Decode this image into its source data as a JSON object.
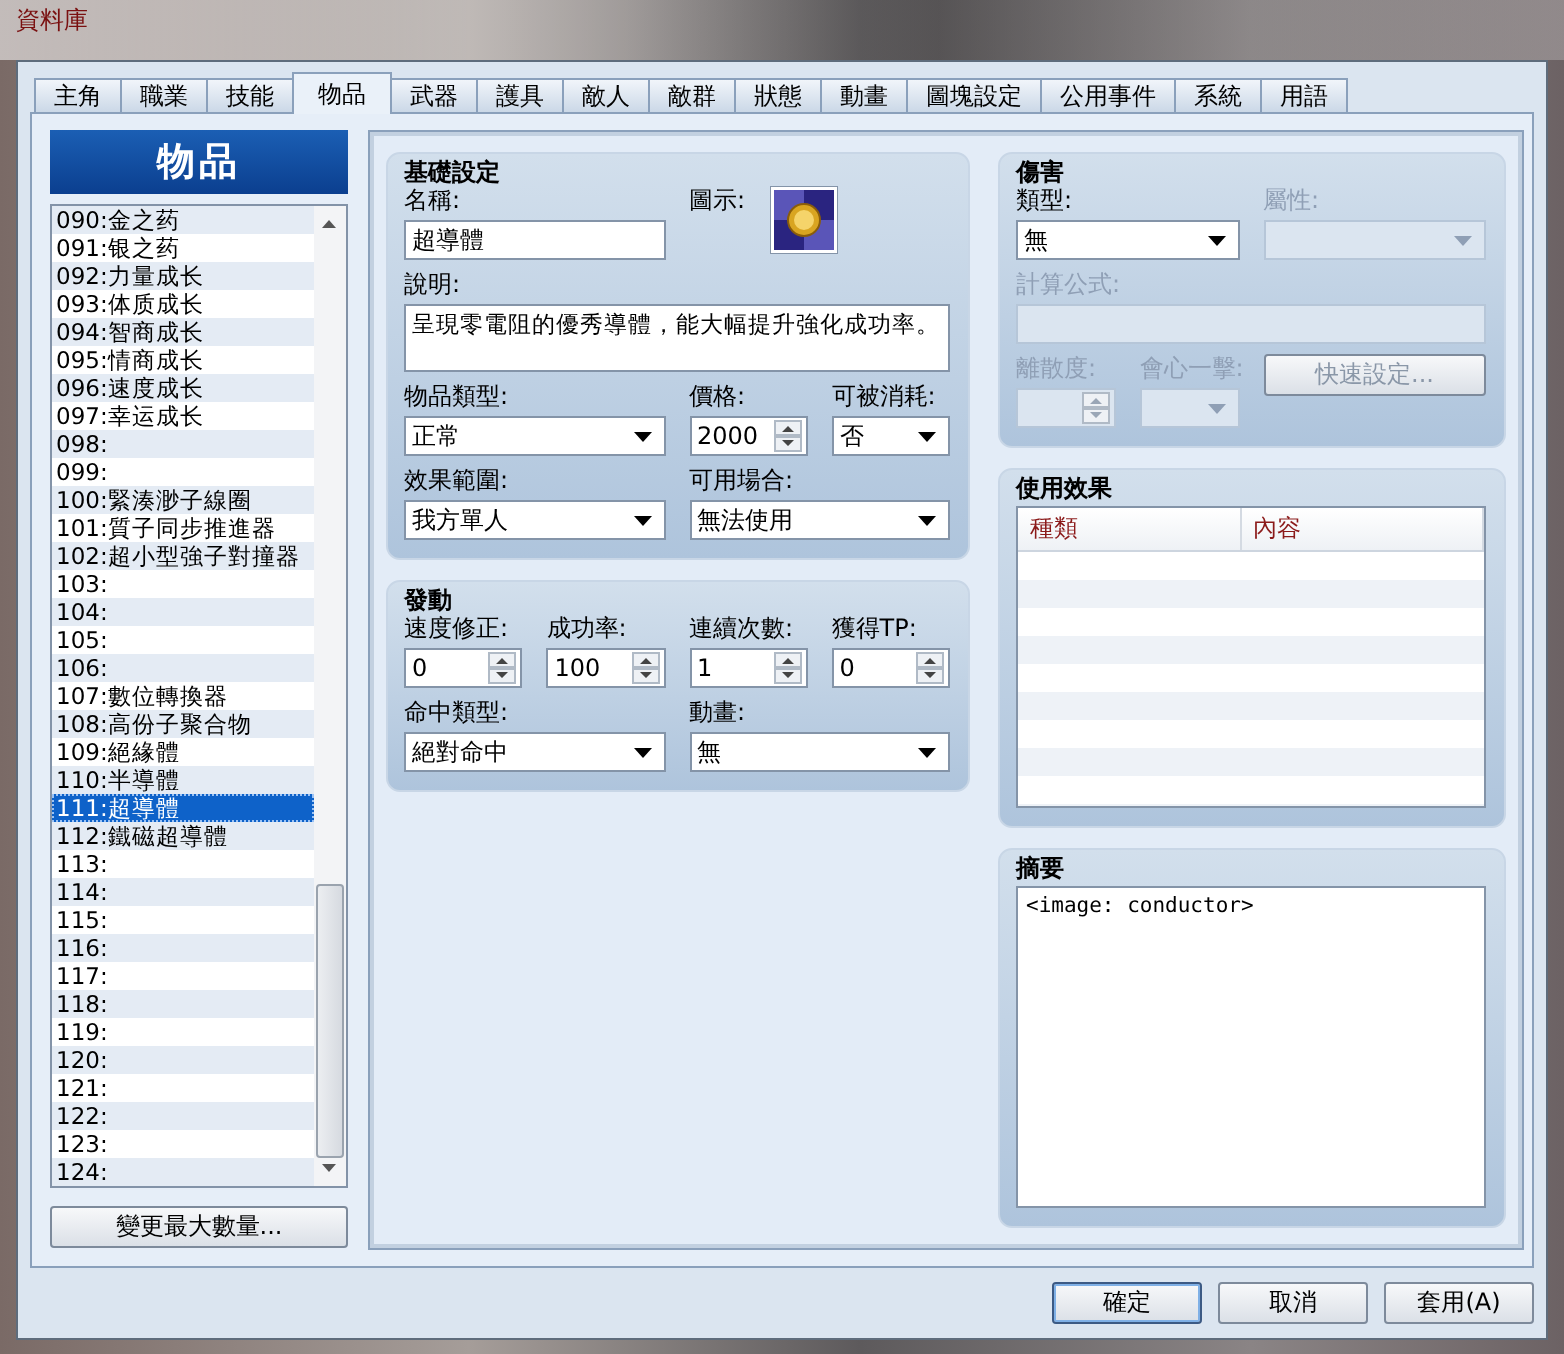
{
  "window": {
    "title": "資料庫"
  },
  "tabs": [
    {
      "label": "主角",
      "selected": false
    },
    {
      "label": "職業",
      "selected": false
    },
    {
      "label": "技能",
      "selected": false
    },
    {
      "label": "物品",
      "selected": true
    },
    {
      "label": "武器",
      "selected": false
    },
    {
      "label": "護具",
      "selected": false
    },
    {
      "label": "敵人",
      "selected": false
    },
    {
      "label": "敵群",
      "selected": false
    },
    {
      "label": "狀態",
      "selected": false
    },
    {
      "label": "動畫",
      "selected": false
    },
    {
      "label": "圖塊設定",
      "selected": false
    },
    {
      "label": "公用事件",
      "selected": false
    },
    {
      "label": "系統",
      "selected": false
    },
    {
      "label": "用語",
      "selected": false
    }
  ],
  "item_list": {
    "title": "物品",
    "items": [
      {
        "label": "090:金之药",
        "selected": false
      },
      {
        "label": "091:银之药",
        "selected": false
      },
      {
        "label": "092:力量成长",
        "selected": false
      },
      {
        "label": "093:体质成长",
        "selected": false
      },
      {
        "label": "094:智商成长",
        "selected": false
      },
      {
        "label": "095:情商成长",
        "selected": false
      },
      {
        "label": "096:速度成长",
        "selected": false
      },
      {
        "label": "097:幸运成长",
        "selected": false
      },
      {
        "label": "098:",
        "selected": false
      },
      {
        "label": "099:",
        "selected": false
      },
      {
        "label": "100:緊湊渺子線圈",
        "selected": false
      },
      {
        "label": "101:質子同步推進器",
        "selected": false
      },
      {
        "label": "102:超小型強子對撞器",
        "selected": false
      },
      {
        "label": "103:",
        "selected": false
      },
      {
        "label": "104:",
        "selected": false
      },
      {
        "label": "105:",
        "selected": false
      },
      {
        "label": "106:",
        "selected": false
      },
      {
        "label": "107:數位轉換器",
        "selected": false
      },
      {
        "label": "108:高份子聚合物",
        "selected": false
      },
      {
        "label": "109:絕緣體",
        "selected": false
      },
      {
        "label": "110:半導體",
        "selected": false
      },
      {
        "label": "111:超導體",
        "selected": true
      },
      {
        "label": "112:鐵磁超導體",
        "selected": false
      },
      {
        "label": "113:",
        "selected": false
      },
      {
        "label": "114:",
        "selected": false
      },
      {
        "label": "115:",
        "selected": false
      },
      {
        "label": "116:",
        "selected": false
      },
      {
        "label": "117:",
        "selected": false
      },
      {
        "label": "118:",
        "selected": false
      },
      {
        "label": "119:",
        "selected": false
      },
      {
        "label": "120:",
        "selected": false
      },
      {
        "label": "121:",
        "selected": false
      },
      {
        "label": "122:",
        "selected": false
      },
      {
        "label": "123:",
        "selected": false
      },
      {
        "label": "124:",
        "selected": false
      }
    ],
    "change_max_button": "變更最大數量..."
  },
  "left_sections": [
    {
      "title": "基礎設定",
      "lines": [
        {
          "fields": [
            {
              "kind": "text",
              "label": "名稱:",
              "value": "超導體",
              "disabled": false
            },
            {
              "kind": "icon",
              "label": "圖示:",
              "disabled": false
            }
          ]
        },
        {
          "fields": [
            {
              "kind": "textarea",
              "label": "說明:",
              "value": "呈現零電阻的優秀導體，能大幅提升強化成功率。",
              "disabled": false
            }
          ]
        },
        {
          "fields": [
            {
              "kind": "select",
              "label": "物品類型:",
              "value": "正常",
              "disabled": false
            },
            {
              "kind": "spin",
              "label": "價格:",
              "value": "2000",
              "disabled": false
            },
            {
              "kind": "select",
              "label": "可被消耗:",
              "value": "否",
              "disabled": false
            }
          ]
        },
        {
          "fields": [
            {
              "kind": "select",
              "label": "效果範圍:",
              "value": "我方單人",
              "disabled": false
            },
            {
              "kind": "select",
              "label": "可用場合:",
              "value": "無法使用",
              "disabled": false
            }
          ]
        }
      ]
    },
    {
      "title": "發動",
      "lines": [
        {
          "fields": [
            {
              "kind": "spin",
              "label": "速度修正:",
              "value": "0",
              "disabled": false
            },
            {
              "kind": "spin",
              "label": "成功率:",
              "value": "100",
              "disabled": false
            },
            {
              "kind": "spin",
              "label": "連續次數:",
              "value": "1",
              "disabled": false
            },
            {
              "kind": "spin",
              "label": "獲得TP:",
              "value": "0",
              "disabled": false
            }
          ]
        },
        {
          "fields": [
            {
              "kind": "select",
              "label": "命中類型:",
              "value": "絕對命中",
              "disabled": false
            },
            {
              "kind": "select",
              "label": "動畫:",
              "value": "無",
              "disabled": false
            }
          ]
        }
      ]
    }
  ],
  "damage": {
    "title": "傷害",
    "lines": [
      {
        "fields": [
          {
            "kind": "select",
            "label": "類型:",
            "value": "無",
            "disabled": false
          },
          {
            "kind": "select",
            "label": "屬性:",
            "disabled": true
          }
        ]
      },
      {
        "fields": [
          {
            "kind": "text",
            "label": "計算公式:",
            "disabled": true
          }
        ]
      },
      {
        "fields": [
          {
            "kind": "spin",
            "label": "離散度:",
            "disabled": true
          },
          {
            "kind": "select",
            "label": "會心一擊:",
            "disabled": true
          },
          {
            "kind": "button",
            "label": "快速設定...",
            "disabled": true
          }
        ]
      }
    ]
  },
  "effects": {
    "title": "使用效果",
    "columns": [
      "種類",
      "內容"
    ]
  },
  "note": {
    "title": "摘要",
    "value": "<image: conductor>"
  },
  "buttons": [
    {
      "label": "確定",
      "default": true
    },
    {
      "label": "取消",
      "default": false
    },
    {
      "label": "套用(A)",
      "default": false
    }
  ]
}
